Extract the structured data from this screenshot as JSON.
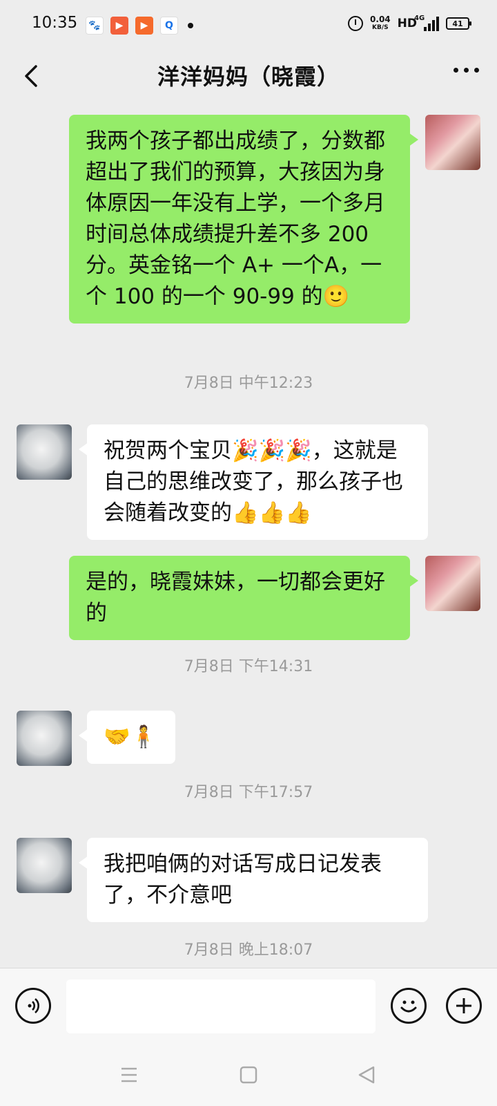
{
  "status_bar": {
    "time": "10:35",
    "net_speed_value": "0.04",
    "net_speed_unit": "KB/S",
    "hd": "HD",
    "network": "4G",
    "battery": "41"
  },
  "header": {
    "title": "洋洋妈妈（晓霞）"
  },
  "messages": [
    {
      "side": "me",
      "text": "我两个孩子都出成绩了，分数都超出了我们的预算，大孩因为身体原因一年没有上学，一个多月时间总体成绩提升差不多 200 分。英金铭一个 A+ 一个A，一个 100 的一个 90-99 的🙂"
    },
    {
      "timestamp": "7月8日 中午12:23"
    },
    {
      "side": "other",
      "text": "祝贺两个宝贝🎉🎉🎉，这就是自己的思维改变了，那么孩子也会随着改变的👍👍👍"
    },
    {
      "side": "me",
      "text": "是的，晓霞妹妹，一切都会更好的"
    },
    {
      "timestamp": "7月8日 下午14:31"
    },
    {
      "side": "other",
      "text": "🤝🧍"
    },
    {
      "timestamp": "7月8日 下午17:57"
    },
    {
      "side": "other",
      "text": "我把咱俩的对话写成日记发表了，不介意吧"
    },
    {
      "timestamp": "7月8日 晚上18:07"
    }
  ],
  "input": {
    "value": ""
  },
  "icons": {
    "back": "chevron-left-icon",
    "more": "more-dots-icon",
    "voice": "voice-icon",
    "emoji": "emoji-icon",
    "plus": "plus-icon",
    "sys_menu": "menu-icon",
    "sys_home": "home-square-icon",
    "sys_back": "back-triangle-icon"
  },
  "colors": {
    "my_bubble": "#95ec69",
    "other_bubble": "#ffffff",
    "background": "#ededed",
    "timestamp_text": "#9a9a9a"
  }
}
